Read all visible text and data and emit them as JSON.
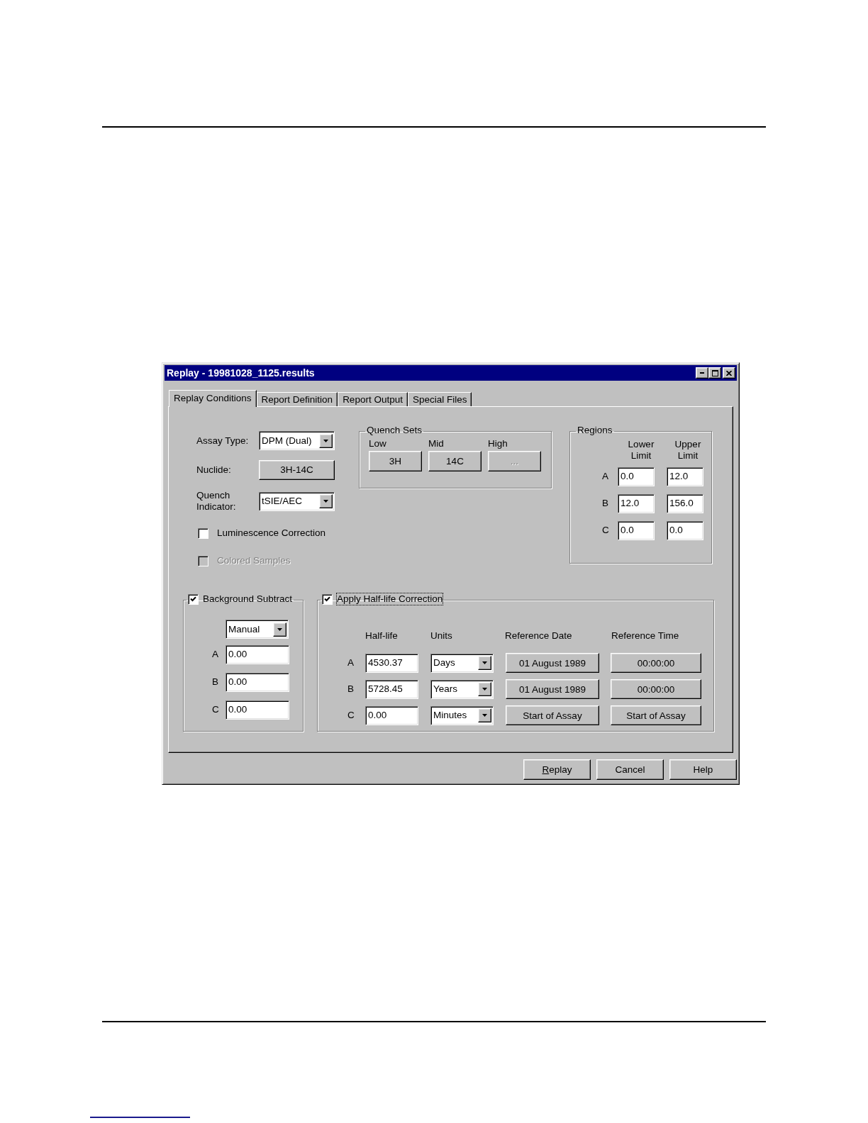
{
  "window": {
    "title": "Replay - 19981028_1125.results"
  },
  "tabs": [
    {
      "label": "Replay Conditions",
      "selected": true
    },
    {
      "label": "Report Definition",
      "selected": false
    },
    {
      "label": "Report Output",
      "selected": false
    },
    {
      "label": "Special Files",
      "selected": false
    }
  ],
  "assay_type": {
    "label": "Assay Type:",
    "value": "DPM (Dual)"
  },
  "nuclide": {
    "label": "Nuclide:",
    "button": "3H-14C"
  },
  "quench_indicator": {
    "label": "Quench Indicator:",
    "value": "tSIE/AEC"
  },
  "options": [
    {
      "label": "Luminescence Correction",
      "checked": false,
      "disabled": false
    },
    {
      "label": "Colored Samples",
      "checked": false,
      "disabled": true
    }
  ],
  "quench_sets": {
    "title": "Quench Sets",
    "sets": [
      {
        "label": "Low",
        "button": "3H",
        "disabled": false
      },
      {
        "label": "Mid",
        "button": "14C",
        "disabled": false
      },
      {
        "label": "High",
        "button": "...",
        "disabled": true
      }
    ]
  },
  "regions": {
    "title": "Regions",
    "columns": [
      "Lower Limit",
      "Upper Limit"
    ],
    "rows": [
      {
        "label": "A",
        "lower": "0.0",
        "upper": "12.0"
      },
      {
        "label": "B",
        "lower": "12.0",
        "upper": "156.0"
      },
      {
        "label": "C",
        "lower": "0.0",
        "upper": "0.0"
      }
    ]
  },
  "background_subtract": {
    "label": "Background Subtract",
    "checked": true,
    "mode": "Manual",
    "rows": [
      {
        "label": "A",
        "value": "0.00"
      },
      {
        "label": "B",
        "value": "0.00"
      },
      {
        "label": "C",
        "value": "0.00"
      }
    ]
  },
  "half_life_correction": {
    "label": "Apply Half-life Correction",
    "checked": true,
    "focused": true,
    "columns": [
      "Half-life",
      "Units",
      "Reference Date",
      "Reference Time"
    ],
    "rows": [
      {
        "label": "A",
        "half_life": "4530.37",
        "units": "Days",
        "reference_date": "01 August 1989",
        "reference_time": "00:00:00"
      },
      {
        "label": "B",
        "half_life": "5728.45",
        "units": "Years",
        "reference_date": "01 August 1989",
        "reference_time": "00:00:00"
      },
      {
        "label": "C",
        "half_life": "0.00",
        "units": "Minutes",
        "reference_date": "Start of Assay",
        "reference_time": "Start of Assay"
      }
    ]
  },
  "buttons": [
    {
      "label": "Replay",
      "mnemonic_underlined": true
    },
    {
      "label": "Cancel",
      "mnemonic_underlined": false
    },
    {
      "label": "Help",
      "mnemonic_underlined": false
    }
  ]
}
